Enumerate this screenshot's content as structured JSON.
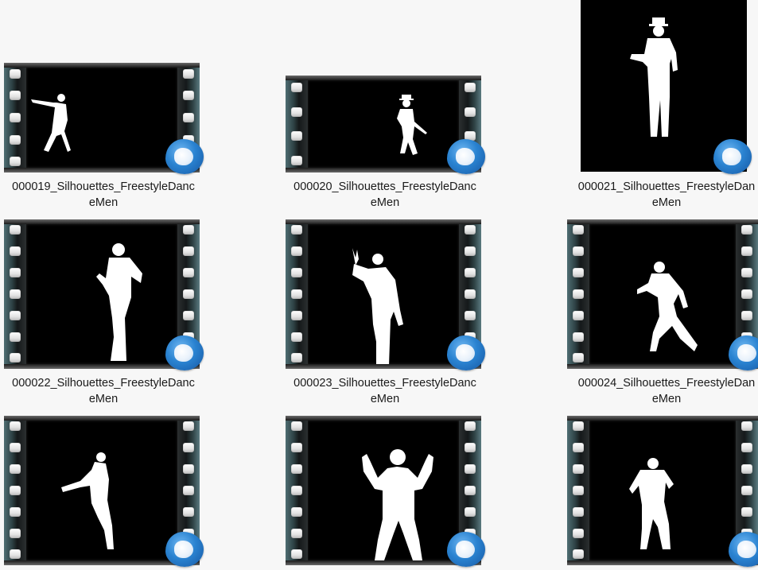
{
  "files": [
    {
      "name_line1": "000019_Silhouettes_FreestyleDanc",
      "name_line2": "eMen",
      "icon": "video-thumbnail-icon",
      "pose": "pointing-right"
    },
    {
      "name_line1": "000020_Silhouettes_FreestyleDanc",
      "name_line2": "eMen",
      "icon": "video-thumbnail-icon",
      "pose": "hat-cane"
    },
    {
      "name_line1": "000021_Silhouettes_FreestyleDan",
      "name_line2": "eMen",
      "icon": "video-thumbnail-icon",
      "pose": "hat-standing"
    },
    {
      "name_line1": "000022_Silhouettes_FreestyleDanc",
      "name_line2": "eMen",
      "icon": "video-thumbnail-icon",
      "pose": "knee-up"
    },
    {
      "name_line1": "000023_Silhouettes_FreestyleDanc",
      "name_line2": "eMen",
      "icon": "video-thumbnail-icon",
      "pose": "hand-raised"
    },
    {
      "name_line1": "000024_Silhouettes_FreestyleDan",
      "name_line2": "eMen",
      "icon": "video-thumbnail-icon",
      "pose": "arms-out-step"
    },
    {
      "name_line1": "",
      "name_line2": "",
      "icon": "video-thumbnail-icon",
      "pose": "lean-back"
    },
    {
      "name_line1": "",
      "name_line2": "",
      "icon": "video-thumbnail-icon",
      "pose": "arms-up"
    },
    {
      "name_line1": "",
      "name_line2": "",
      "icon": "video-thumbnail-icon",
      "pose": "crouch-walk"
    }
  ],
  "badge_icon": "video-player-badge-icon",
  "colors": {
    "background": "#f7f7f7",
    "badge": "#2a83d1",
    "text": "#1a1a1a"
  }
}
